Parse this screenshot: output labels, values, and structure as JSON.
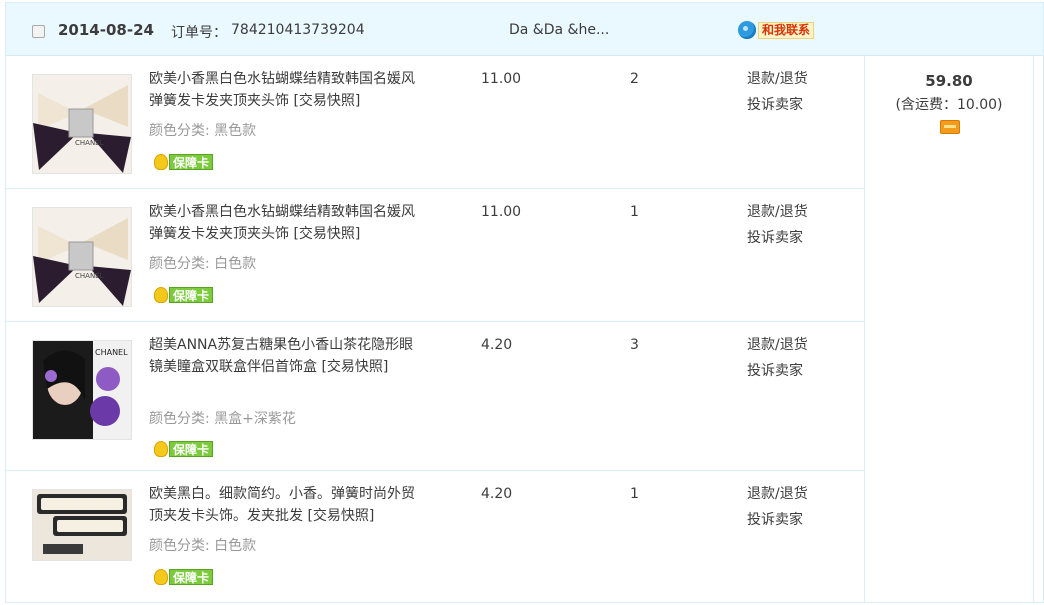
{
  "order": {
    "date": "2014-08-24",
    "order_no_label": "订单号：",
    "order_no": "784210413739204",
    "seller": "Da &Da &he...",
    "contact_label": "和我联系",
    "total_amount": "59.80",
    "shipping_note": "(含运费：10.00)"
  },
  "items": [
    {
      "title": "欧美小香黑白色水钻蝴蝶结精致韩国名媛风弹簧发卡发夹顶夹头饰 [交易快照]",
      "attr": "颜色分类: 黑色款",
      "badge": "保障卡",
      "price": "11.00",
      "qty": "2",
      "action1": "退款/退货",
      "action2": "投诉卖家"
    },
    {
      "title": "欧美小香黑白色水钻蝴蝶结精致韩国名媛风弹簧发卡发夹顶夹头饰 [交易快照]",
      "attr": "颜色分类: 白色款",
      "badge": "保障卡",
      "price": "11.00",
      "qty": "1",
      "action1": "退款/退货",
      "action2": "投诉卖家"
    },
    {
      "title": "超美ANNA苏复古糖果色小香山茶花隐形眼镜美瞳盒双联盒伴侣首饰盒 [交易快照]",
      "attr": "颜色分类: 黑盒+深紫花",
      "badge": "保障卡",
      "price": "4.20",
      "qty": "3",
      "action1": "退款/退货",
      "action2": "投诉卖家"
    },
    {
      "title": "欧美黑白。细款简约。小香。弹簧时尚外贸顶夹发卡头饰。发夹批发 [交易快照]",
      "attr": "颜色分类: 白色款",
      "badge": "保障卡",
      "price": "4.20",
      "qty": "1",
      "action1": "退款/退货",
      "action2": "投诉卖家"
    }
  ]
}
